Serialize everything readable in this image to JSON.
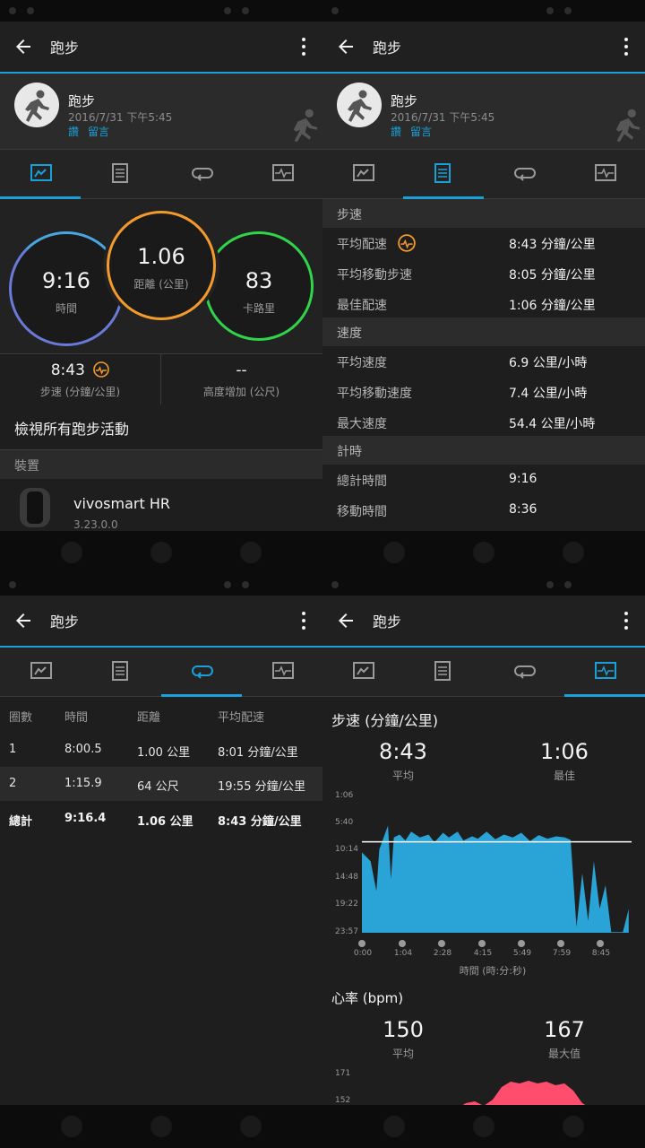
{
  "app": {
    "title": "跑步"
  },
  "activity": {
    "name": "跑步",
    "date": "2016/7/31 下午5:45",
    "like": "讚",
    "comment": "留言"
  },
  "summary": {
    "time_value": "9:16",
    "time_label": "時間",
    "distance_value": "1.06",
    "distance_label": "距離 (公里)",
    "calories_value": "83",
    "calories_label": "卡路里",
    "pace_value": "8:43",
    "pace_label": "步速 (分鐘/公里)",
    "elev_value": "--",
    "elev_label": "高度增加 (公尺)",
    "view_all": "檢視所有跑步活動",
    "device_section": "裝置",
    "device_name": "vivosmart HR",
    "device_version": "3.23.0.0"
  },
  "details": {
    "pace_header": "步速",
    "avg_pace_label": "平均配速",
    "avg_pace_value": "8:43 分鐘/公里",
    "avg_move_pace_label": "平均移動步速",
    "avg_move_pace_value": "8:05 分鐘/公里",
    "best_pace_label": "最佳配速",
    "best_pace_value": "1:06 分鐘/公里",
    "speed_header": "速度",
    "avg_speed_label": "平均速度",
    "avg_speed_value": "6.9 公里/小時",
    "avg_move_speed_label": "平均移動速度",
    "avg_move_speed_value": "7.4 公里/小時",
    "max_speed_label": "最大速度",
    "max_speed_value": "54.4 公里/小時",
    "timing_header": "計時",
    "total_time_label": "總計時間",
    "total_time_value": "9:16",
    "moving_time_label": "移動時間",
    "moving_time_value": "8:36"
  },
  "laps": {
    "headers": [
      "圈數",
      "時間",
      "距離",
      "平均配速"
    ],
    "rows": [
      [
        "1",
        "8:00.5",
        "1.00 公里",
        "8:01 分鐘/公里"
      ],
      [
        "2",
        "1:15.9",
        "64 公尺",
        "19:55 分鐘/公里"
      ]
    ],
    "total": [
      "總計",
      "9:16.4",
      "1.06 公里",
      "8:43 分鐘/公里"
    ]
  },
  "charts": {
    "pace_title": "步速 (分鐘/公里)",
    "pace_avg_value": "8:43",
    "pace_avg_label": "平均",
    "pace_best_value": "1:06",
    "pace_best_label": "最佳",
    "pace_x_axis_label": "時間 (時:分:秒)",
    "hr_title": "心率 (bpm)",
    "hr_avg_value": "150",
    "hr_avg_label": "平均",
    "hr_max_value": "167",
    "hr_max_label": "最大值",
    "hr_y_top": "171",
    "hr_y_next": "152"
  },
  "chart_data": {
    "type": "area",
    "title": "步速 (分鐘/公里)",
    "xlabel": "時間 (時:分:秒)",
    "x_ticks": [
      "0:00",
      "1:04",
      "2:28",
      "4:15",
      "5:49",
      "7:59",
      "8:45"
    ],
    "y_ticks": [
      "1:06",
      "5:40",
      "10:14",
      "14:48",
      "19:22",
      "23:57"
    ],
    "y_reversed": true,
    "average_line": "8:43",
    "series": [
      {
        "x_min": [
          0.0,
          0.3,
          0.5,
          0.6,
          0.9,
          1.0,
          1.1,
          1.3,
          1.5,
          1.7,
          2.0,
          2.3,
          2.5,
          2.8,
          3.0,
          3.3,
          3.5,
          3.8,
          4.0,
          4.3,
          4.6,
          4.9,
          5.2,
          5.5,
          5.8,
          6.1,
          6.4,
          6.7,
          7.0,
          7.2,
          7.4,
          7.6,
          7.8,
          8.0,
          8.2,
          8.4,
          8.6,
          8.8,
          9.0,
          9.2
        ],
        "pace_min": [
          10.5,
          12.0,
          17.0,
          10.0,
          6.0,
          15.0,
          8.0,
          7.5,
          8.5,
          7.0,
          8.0,
          7.5,
          8.8,
          7.2,
          8.0,
          7.0,
          8.5,
          7.8,
          8.2,
          7.0,
          8.3,
          7.5,
          8.0,
          7.2,
          8.6,
          7.6,
          8.2,
          7.8,
          8.0,
          8.4,
          23.0,
          14.0,
          22.0,
          12.0,
          20.0,
          16.0,
          23.9,
          23.9,
          23.9,
          20.0
        ]
      }
    ]
  },
  "colors": {
    "accent": "#1aa0d8",
    "time_ring": "#6a7ad8",
    "distance_ring": "#f39a2c",
    "calories_ring": "#2fd44a",
    "pace_fill": "#2aa3d6",
    "hr_fill": "#ff4d6d"
  }
}
